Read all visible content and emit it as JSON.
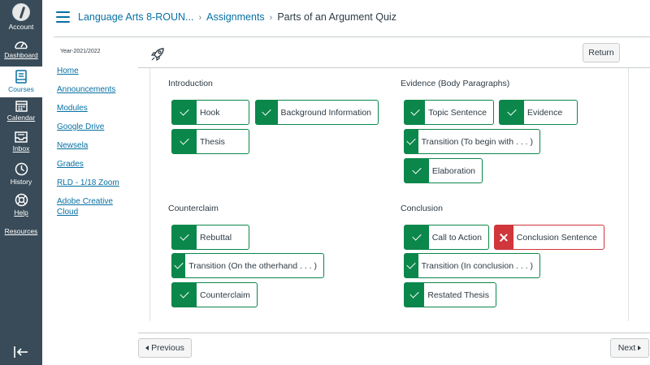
{
  "global_nav": {
    "items": [
      {
        "label": "Account",
        "icon": "avatar-icon"
      },
      {
        "label": "Dashboard",
        "icon": "dashboard-icon"
      },
      {
        "label": "Courses",
        "icon": "courses-icon"
      },
      {
        "label": "Calendar",
        "icon": "calendar-icon"
      },
      {
        "label": "Inbox",
        "icon": "inbox-icon"
      },
      {
        "label": "History",
        "icon": "history-icon"
      },
      {
        "label": "Help",
        "icon": "help-icon"
      },
      {
        "label": "Resources",
        "icon": ""
      }
    ],
    "collapse_icon": "collapse-nav-icon"
  },
  "header": {
    "breadcrumb": [
      "Language Arts 8-ROUN...",
      "Assignments",
      "Parts of an Argument Quiz"
    ]
  },
  "course_nav": {
    "year_label": "Year-2021/2022",
    "links": [
      "Home",
      "Announcements",
      "Modules",
      "Google Drive",
      "Newsela",
      "Grades",
      "RLD - 1/18 Zoom",
      "Adobe Creative Cloud"
    ]
  },
  "toolbar": {
    "icon": "rocket-icon",
    "return_label": "Return"
  },
  "quiz": {
    "sections": [
      {
        "title": "Introduction",
        "chips": [
          {
            "label": "Hook",
            "status": "correct"
          },
          {
            "label": "Background Information",
            "status": "correct"
          },
          {
            "label": "Thesis",
            "status": "correct"
          }
        ]
      },
      {
        "title": "Evidence (Body Paragraphs)",
        "chips": [
          {
            "label": "Topic Sentence",
            "status": "correct"
          },
          {
            "label": "Evidence",
            "status": "correct"
          },
          {
            "label": "Transition (To begin with . . . )",
            "status": "correct"
          },
          {
            "label": "Elaboration",
            "status": "correct"
          }
        ]
      },
      {
        "title": "Counterclaim",
        "chips": [
          {
            "label": "Rebuttal",
            "status": "correct"
          },
          {
            "label": "Transition (On the otherhand . . . )",
            "status": "correct"
          },
          {
            "label": "Counterclaim",
            "status": "correct"
          }
        ]
      },
      {
        "title": "Conclusion",
        "chips": [
          {
            "label": "Call to Action",
            "status": "correct"
          },
          {
            "label": "Conclusion Sentence",
            "status": "incorrect"
          },
          {
            "label": "Transition (In conclusion . . . )",
            "status": "correct"
          },
          {
            "label": "Restated Thesis",
            "status": "correct"
          }
        ]
      }
    ]
  },
  "pager": {
    "previous_label": "Previous",
    "next_label": "Next"
  },
  "colors": {
    "nav_bg": "#394b58",
    "link": "#0770a3",
    "correct": "#0b874b",
    "incorrect": "#d0363a"
  }
}
